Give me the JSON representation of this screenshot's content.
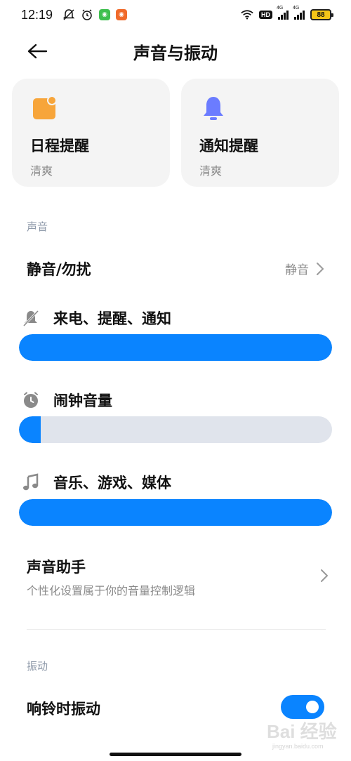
{
  "status_bar": {
    "time": "12:19",
    "hd": "HD",
    "net1": "4G",
    "net2": "4G",
    "battery": "88"
  },
  "header": {
    "title": "声音与振动",
    "back_icon": "arrow-left-icon"
  },
  "cards": [
    {
      "title": "日程提醒",
      "subtitle": "清爽",
      "icon": "calendar-note-icon",
      "color": "#f7a53a"
    },
    {
      "title": "通知提醒",
      "subtitle": "清爽",
      "icon": "bell-icon",
      "color": "#6b7cff"
    }
  ],
  "sound_section": {
    "label": "声音",
    "mute": {
      "title": "静音/勿扰",
      "value": "静音"
    },
    "volumes": [
      {
        "label": "来电、提醒、通知",
        "icon": "bell-muted-icon",
        "level": 1.0
      },
      {
        "label": "闹钟音量",
        "icon": "alarm-clock-icon",
        "level": 0.07
      },
      {
        "label": "音乐、游戏、媒体",
        "icon": "music-note-icon",
        "level": 1.0
      }
    ],
    "assistant": {
      "title": "声音助手",
      "subtitle": "个性化设置属于你的音量控制逻辑"
    }
  },
  "vibration_section": {
    "label": "振动",
    "ring_vibrate": {
      "title": "响铃时振动",
      "enabled": true
    }
  },
  "watermark": {
    "text": "Bai 经验",
    "sub": "jingyan.baidu.com"
  },
  "colors": {
    "accent": "#0a84ff",
    "slider_track": "#e0e4ec",
    "card_bg": "#f4f4f4"
  }
}
